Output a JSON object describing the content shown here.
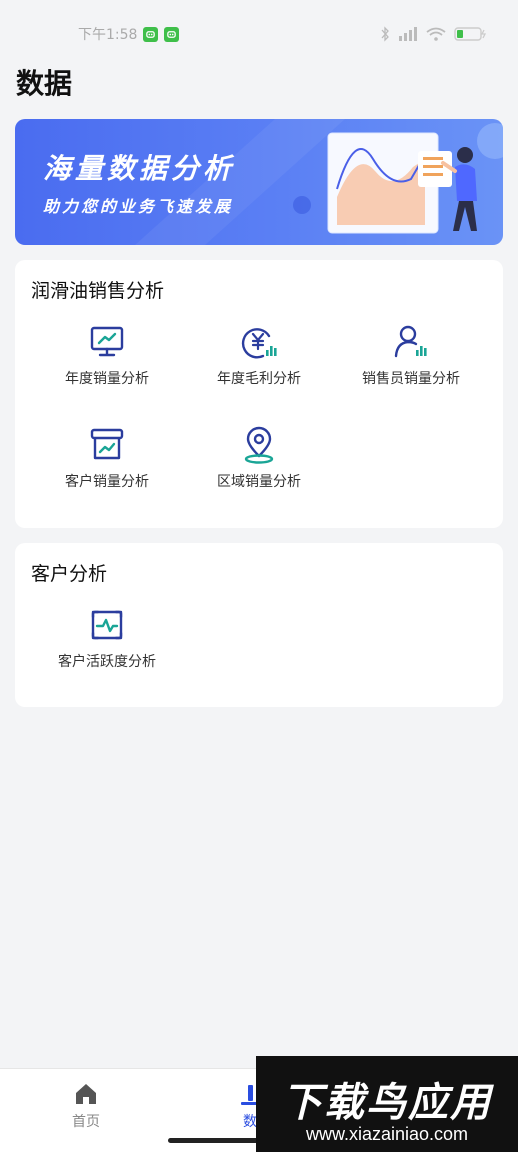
{
  "statusbar": {
    "time": "下午1:58"
  },
  "page": {
    "title": "数据"
  },
  "banner": {
    "title": "海量数据分析",
    "subtitle": "助力您的业务飞速发展"
  },
  "sections": [
    {
      "title": "润滑油销售分析",
      "items": [
        {
          "label": "年度销量分析",
          "icon": "monitor-chart-icon"
        },
        {
          "label": "年度毛利分析",
          "icon": "yen-chart-icon"
        },
        {
          "label": "销售员销量分析",
          "icon": "person-chart-icon"
        },
        {
          "label": "客户销量分析",
          "icon": "box-chart-icon"
        },
        {
          "label": "区域销量分析",
          "icon": "location-pin-icon"
        }
      ]
    },
    {
      "title": "客户分析",
      "items": [
        {
          "label": "客户活跃度分析",
          "icon": "pulse-screen-icon"
        }
      ]
    }
  ],
  "tabbar": {
    "items": [
      {
        "label": "首页",
        "icon": "home-icon",
        "active": false
      },
      {
        "label": "数",
        "icon": "data-icon",
        "active": true
      }
    ]
  },
  "watermark": {
    "main": "下载鸟应用",
    "url": "www.xiazainiao.com"
  },
  "colors": {
    "accent": "#2a4de0",
    "icon_teal": "#1aa596",
    "banner": "#4a6cf0",
    "background": "#f3f4f6"
  }
}
